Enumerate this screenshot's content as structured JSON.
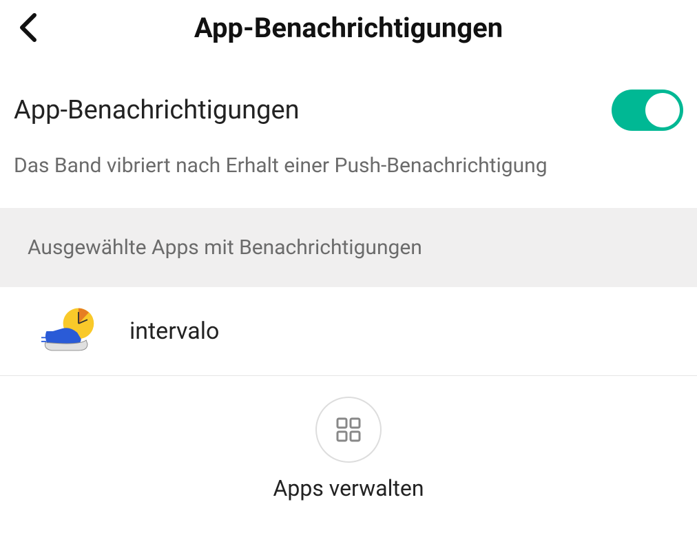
{
  "header": {
    "title": "App-Benachrichtigungen"
  },
  "notifications": {
    "title": "App-Benachrichtigungen",
    "description": "Das Band vibriert nach Erhalt einer Push-Benachrichtigung",
    "toggle_on": true
  },
  "selected": {
    "label": "Ausgewählte Apps mit Benachrichtigungen"
  },
  "apps": [
    {
      "name": "intervalo"
    }
  ],
  "footer": {
    "manage_label": "Apps verwalten"
  }
}
